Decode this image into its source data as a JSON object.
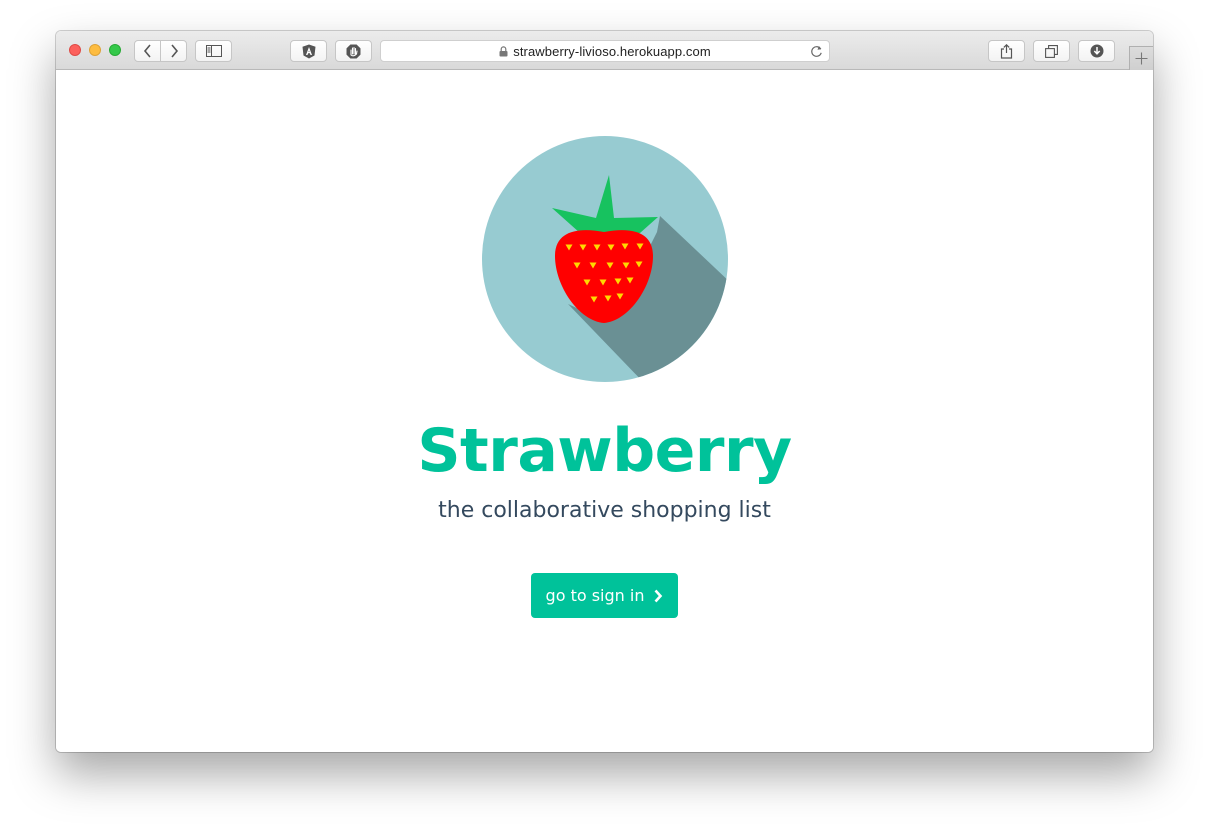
{
  "browser": {
    "url": "strawberry-livioso.herokuapp.com",
    "icons": {
      "close": "close-icon",
      "minimize": "minimize-icon",
      "maximize": "maximize-icon",
      "back": "chevron-left-icon",
      "forward": "chevron-right-icon",
      "sidebar": "sidebar-icon",
      "angular_extension": "angular-icon",
      "adblock_extension": "hand-stop-icon",
      "lock": "lock-icon",
      "reload": "reload-icon",
      "share": "share-icon",
      "tabs": "tabs-icon",
      "downloads": "download-icon",
      "new_tab": "plus-icon"
    }
  },
  "page": {
    "logo": "strawberry-logo",
    "title": "Strawberry",
    "tagline": "the collaborative shopping list",
    "cta_label": "go to sign in",
    "cta_icon": "chevron-right-icon"
  },
  "colors": {
    "accent": "#00c29a",
    "text_dark": "#34495e",
    "logo_circle": "#97cbd1",
    "logo_shadow": "#6a9094",
    "strawberry_red": "#ff0000",
    "leaf_green": "#17c25f",
    "seed_yellow": "#ffd900"
  }
}
